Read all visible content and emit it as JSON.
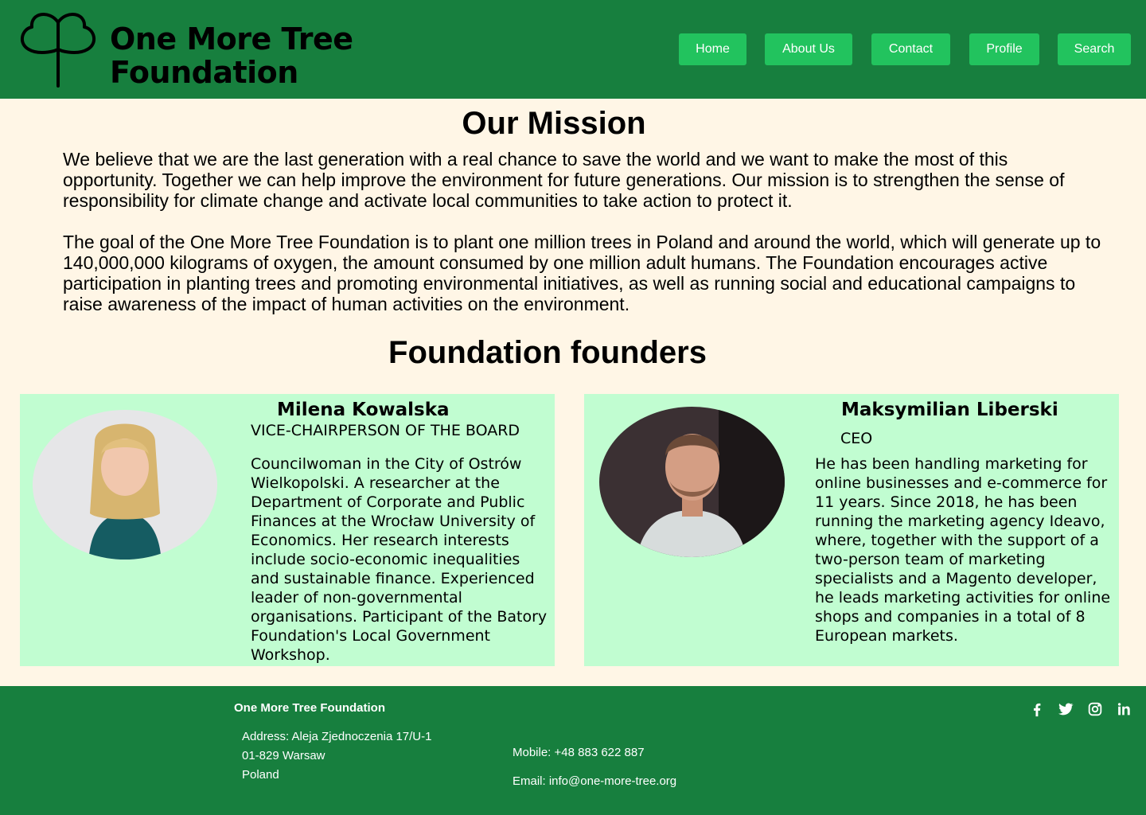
{
  "brand": {
    "name_line1": "One More Tree",
    "name_line2": "Foundation",
    "logo_icon": "clover-tree-icon"
  },
  "nav": {
    "home": "Home",
    "about": "About Us",
    "contact": "Contact",
    "profile": "Profile",
    "search": "Search"
  },
  "colors": {
    "header_bg": "#177f3e",
    "nav_button": "#22c35e",
    "page_bg": "#fff6e6",
    "card_bg": "#c1fdd1"
  },
  "mission": {
    "title": "Our Mission",
    "paragraph1": "We believe that we are the last generation with a real chance to save the world and we want to make the most of this opportunity. Together we can help improve the environment for future generations. Our mission is to strengthen the sense of responsibility for climate change and activate local communities to take action to protect it.",
    "paragraph2": "The goal of the One More Tree Foundation is to plant one million trees in Poland and around the world, which will generate up to 140,000,000 kilograms of oxygen, the amount consumed by one million adult humans. The Foundation encourages active participation in planting trees and promoting environmental initiatives, as well as running social and educational campaigns to raise awareness of the impact of human activities on the environment."
  },
  "founders": {
    "title": "Foundation founders",
    "list": [
      {
        "name": "Milena Kowalska",
        "role": "VICE-CHAIRPERSON OF THE BOARD",
        "bio": "Councilwoman in the City of Ostrów Wielkopolski. A researcher at the Department of Corporate and Public Finances at the Wrocław University of Economics. Her research interests include socio-economic inequalities and sustainable finance. Experienced leader of non-governmental organisations. Participant of the Batory Foundation's Local Government Workshop."
      },
      {
        "name": "Maksymilian Liberski",
        "role": "CEO",
        "bio": "He has been handling marketing for online businesses and e-commerce for 11 years. Since 2018, he has been running the marketing agency Ideavo, where, together with the support of a two-person team of marketing specialists and a Magento developer, he leads marketing activities for online shops and companies in a total of 8 European markets."
      }
    ]
  },
  "footer": {
    "title": "One More Tree Foundation",
    "address_line1": "Address: Aleja Zjednoczenia 17/U-1",
    "address_line2": "01-829 Warsaw",
    "address_line3": "Poland",
    "mobile": "Mobile: +48 883 622 887",
    "email": "Email: info@one-more-tree.org",
    "social_icons": [
      "facebook-icon",
      "twitter-icon",
      "instagram-icon",
      "linkedin-icon"
    ]
  }
}
